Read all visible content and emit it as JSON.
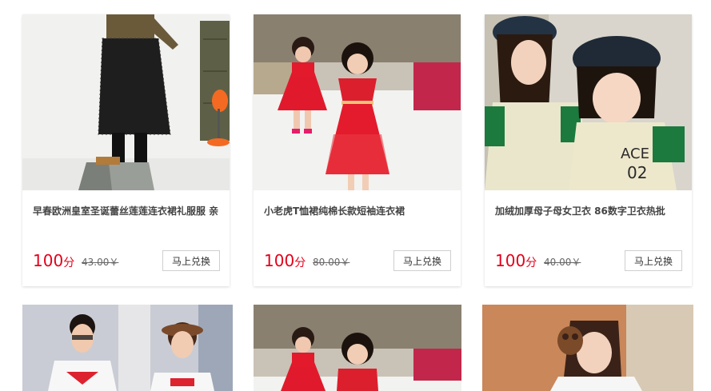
{
  "products": [
    {
      "title": "早春欧洲皇室圣诞蕾丝莲莲连衣裙礼服服 亲",
      "points": "100",
      "points_unit": "分",
      "old_price": "43.00￥",
      "button_label": "马上兑换",
      "image": "lace-skirt-photo"
    },
    {
      "title": "小老虎T恤裙纯棉长款短袖连衣裙",
      "points": "100",
      "points_unit": "分",
      "old_price": "80.00￥",
      "button_label": "马上兑换",
      "image": "red-dresses-photo"
    },
    {
      "title": "加绒加厚母子母女卫衣 86数字卫衣热批",
      "points": "100",
      "points_unit": "分",
      "old_price": "40.00￥",
      "button_label": "马上兑换",
      "image": "mother-daughter-photo"
    }
  ],
  "partial_products": [
    {
      "image": "couple-tshirt-photo"
    },
    {
      "image": "red-dresses-photo"
    },
    {
      "image": "earmuff-girl-photo"
    }
  ],
  "colors": {
    "price_red": "#e4001b",
    "text_dark": "#444444"
  }
}
